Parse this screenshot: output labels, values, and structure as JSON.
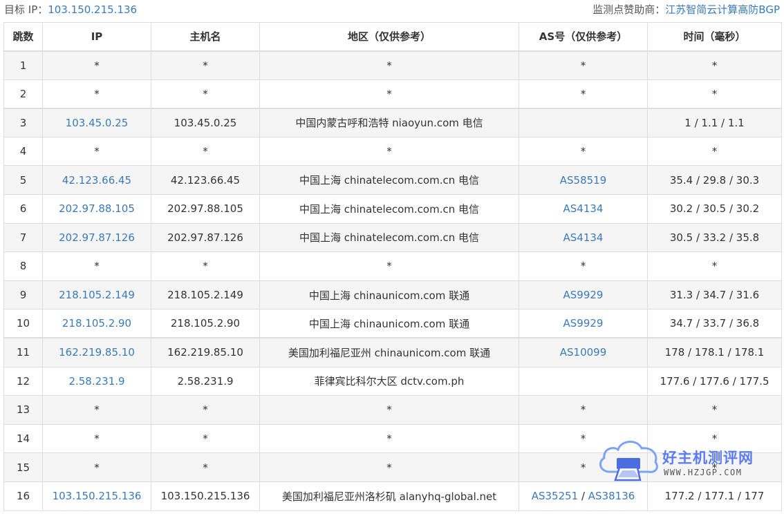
{
  "header": {
    "target_label": "目标 IP：",
    "target_ip": "103.150.215.136",
    "sponsor_label": "监测点赞助商：",
    "sponsor_name": "江苏智简云计算高防BGP"
  },
  "columns": [
    "跳数",
    "IP",
    "主机名",
    "地区（仅供参考）",
    "AS号（仅供参考）",
    "时间（毫秒）"
  ],
  "rows": [
    {
      "hop": "1",
      "ip": "*",
      "host": "*",
      "region": "*",
      "as1": "*",
      "as_sep": "",
      "as2": "",
      "time": "*"
    },
    {
      "hop": "2",
      "ip": "*",
      "host": "*",
      "region": "*",
      "as1": "*",
      "as_sep": "",
      "as2": "",
      "time": "*"
    },
    {
      "hop": "3",
      "ip": "103.45.0.25",
      "host": "103.45.0.25",
      "region": "中国内蒙古呼和浩特 niaoyun.com 电信",
      "as1": "",
      "as_sep": "",
      "as2": "",
      "time": "1 / 1.1 / 1.1"
    },
    {
      "hop": "4",
      "ip": "*",
      "host": "*",
      "region": "*",
      "as1": "*",
      "as_sep": "",
      "as2": "",
      "time": "*"
    },
    {
      "hop": "5",
      "ip": "42.123.66.45",
      "host": "42.123.66.45",
      "region": "中国上海 chinatelecom.com.cn 电信",
      "as1": "AS58519",
      "as_sep": "",
      "as2": "",
      "time": "35.4 / 29.8 / 30.3"
    },
    {
      "hop": "6",
      "ip": "202.97.88.105",
      "host": "202.97.88.105",
      "region": "中国上海 chinatelecom.com.cn 电信",
      "as1": "AS4134",
      "as_sep": "",
      "as2": "",
      "time": "30.2 / 30.5 / 30.2"
    },
    {
      "hop": "7",
      "ip": "202.97.87.126",
      "host": "202.97.87.126",
      "region": "中国上海 chinatelecom.com.cn 电信",
      "as1": "AS4134",
      "as_sep": "",
      "as2": "",
      "time": "30.5 / 33.2 / 35.8"
    },
    {
      "hop": "8",
      "ip": "*",
      "host": "*",
      "region": "*",
      "as1": "*",
      "as_sep": "",
      "as2": "",
      "time": "*"
    },
    {
      "hop": "9",
      "ip": "218.105.2.149",
      "host": "218.105.2.149",
      "region": "中国上海 chinaunicom.com 联通",
      "as1": "AS9929",
      "as_sep": "",
      "as2": "",
      "time": "31.3 / 34.7 / 31.6"
    },
    {
      "hop": "10",
      "ip": "218.105.2.90",
      "host": "218.105.2.90",
      "region": "中国上海 chinaunicom.com 联通",
      "as1": "AS9929",
      "as_sep": "",
      "as2": "",
      "time": "34.7 / 33.7 / 36.8"
    },
    {
      "hop": "11",
      "ip": "162.219.85.10",
      "host": "162.219.85.10",
      "region": "美国加利福尼亚州 chinaunicom.com 联通",
      "as1": "AS10099",
      "as_sep": "",
      "as2": "",
      "time": "178 / 178.1 / 178.1"
    },
    {
      "hop": "12",
      "ip": "2.58.231.9",
      "host": "2.58.231.9",
      "region": "菲律宾比科尔大区 dctv.com.ph",
      "as1": "",
      "as_sep": "",
      "as2": "",
      "time": "177.6 / 177.6 / 177.5"
    },
    {
      "hop": "13",
      "ip": "*",
      "host": "*",
      "region": "*",
      "as1": "*",
      "as_sep": "",
      "as2": "",
      "time": "*"
    },
    {
      "hop": "14",
      "ip": "*",
      "host": "*",
      "region": "*",
      "as1": "*",
      "as_sep": "",
      "as2": "",
      "time": "*"
    },
    {
      "hop": "15",
      "ip": "*",
      "host": "*",
      "region": "*",
      "as1": "*",
      "as_sep": "",
      "as2": "",
      "time": "*"
    },
    {
      "hop": "16",
      "ip": "103.150.215.136",
      "host": "103.150.215.136",
      "region": "美国加利福尼亚州洛杉矶 alanyhq-global.net",
      "as1": "AS35251",
      "as_sep": " / ",
      "as2": "AS38136",
      "time": "177.2 / 177.1 / 177"
    }
  ],
  "watermark": {
    "title": "好主机测评网",
    "url": "WWW.HZJGP.COM",
    "icon": "cloud-printer-logo"
  },
  "colors": {
    "link": "#3a7ab8",
    "stripe": "#f5f5f5",
    "border": "#dddddd",
    "watermark_blue": "#5b7cf0"
  }
}
